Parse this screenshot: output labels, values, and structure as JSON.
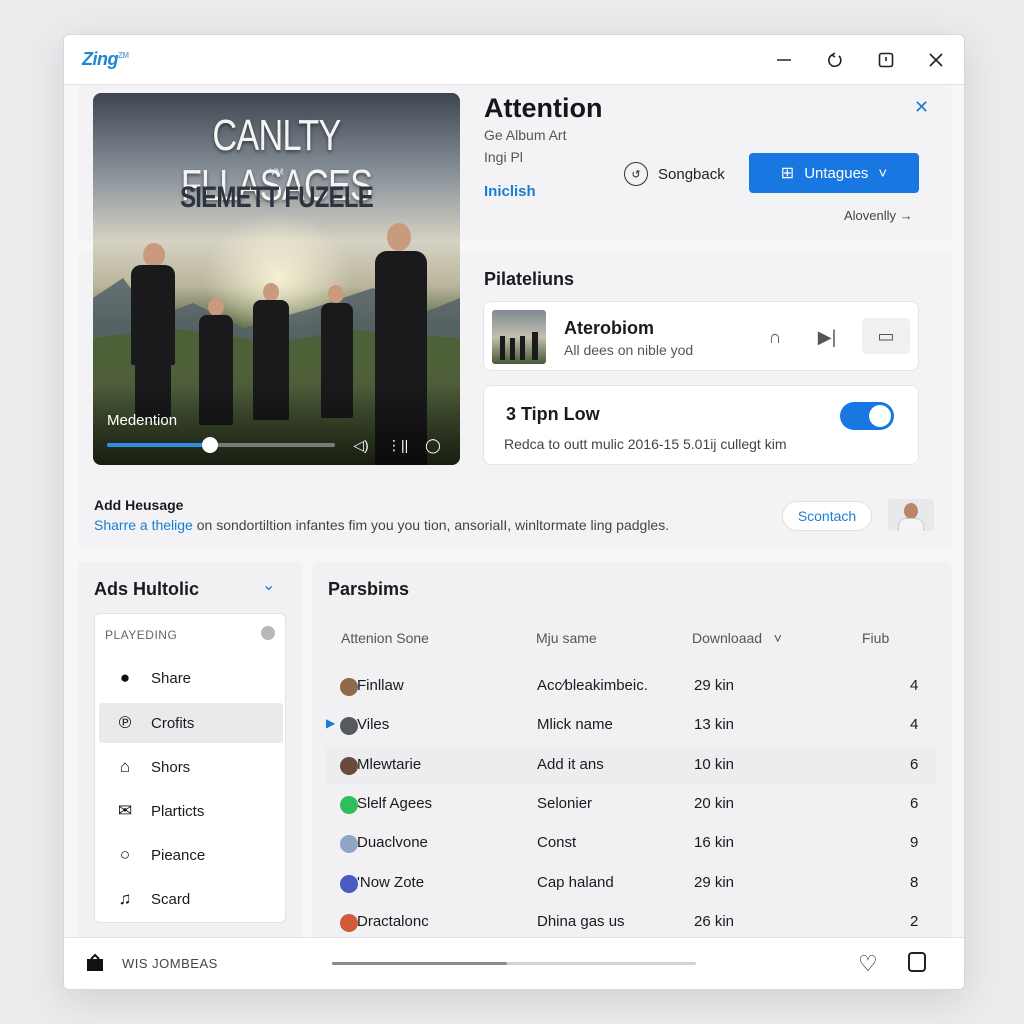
{
  "app": {
    "logo": "Zing",
    "logo_sup": "ZM"
  },
  "window_controls": {
    "minimize": "minimize-icon",
    "refresh": "refresh-icon",
    "maximize": "maximize-icon",
    "close": "close-icon"
  },
  "album": {
    "art_title": "CANLTY FLLASACES",
    "art_mid": "VM",
    "art_sub": "SIEMETT FUZELE",
    "now_label": "Medention",
    "progress": 0.45
  },
  "song": {
    "title": "Attention",
    "meta1": "Ge Album Art",
    "meta2": "Ingi Pl",
    "link": "Iniclish",
    "songback_label": "Songback",
    "primary_label": "Untagues",
    "more_label": "Alovenlly →"
  },
  "playlists": {
    "heading": "Pilateliuns",
    "card": {
      "title": "Aterobiom",
      "subtitle": "All dees on nible yod"
    },
    "toggle_card": {
      "title": "3 Tipn Low",
      "subtitle": "Redca to outt mulic 2016-15 5.01ĳ cullegt kim",
      "on": true
    }
  },
  "message": {
    "title": "Add Heusage",
    "link": "Sharre a thelige",
    "body": " on sondortiltion infantes fim you you tion, ansorialI, winltormate ling padgles.",
    "button": "Scontach"
  },
  "sidebar": {
    "heading": "Ads Hultolic",
    "section_label": "PLAYEDING",
    "items": [
      {
        "label": "Share",
        "icon": "apple-icon"
      },
      {
        "label": "Crofits",
        "icon": "pinterest-icon"
      },
      {
        "label": "Shors",
        "icon": "home-icon"
      },
      {
        "label": "Plarticts",
        "icon": "mail-icon"
      },
      {
        "label": "Pieance",
        "icon": "chat-icon"
      },
      {
        "label": "Scard",
        "icon": "music-note-icon"
      }
    ]
  },
  "table": {
    "heading": "Parsbims",
    "columns": [
      "Attenion Sone",
      "Mju same",
      "Downloaad",
      "Fiub"
    ],
    "rows": [
      {
        "name": "Finllaw",
        "artist": "Acc⁄bleakimbeic.",
        "dl": "29 kin",
        "num": "4",
        "color": "#8c6a4a"
      },
      {
        "name": "Viles",
        "artist": "Mlick name",
        "dl": "13 kin",
        "num": "4",
        "color": "#555a60"
      },
      {
        "name": "Mlewtarie",
        "artist": "Add it ans",
        "dl": "10 kin",
        "num": "6",
        "color": "#6a4a3c"
      },
      {
        "name": "Slelf Agees",
        "artist": "Selonier",
        "dl": "20 kin",
        "num": "6",
        "color": "#2fbf5a"
      },
      {
        "name": "Duaclvone",
        "artist": "Const",
        "dl": "16 kin",
        "num": "9",
        "color": "#8fa6c4"
      },
      {
        "name": "'Now Zote",
        "artist": "Cap haland",
        "dl": "29 kin",
        "num": "8",
        "color": "#4a5bc4"
      },
      {
        "name": "Dractalonc",
        "artist": "Dhina gas us",
        "dl": "26 kin",
        "num": "2",
        "color": "#d05a3c"
      }
    ]
  },
  "bottom": {
    "text": "WIS JOMBEAS",
    "progress": 0.48
  }
}
